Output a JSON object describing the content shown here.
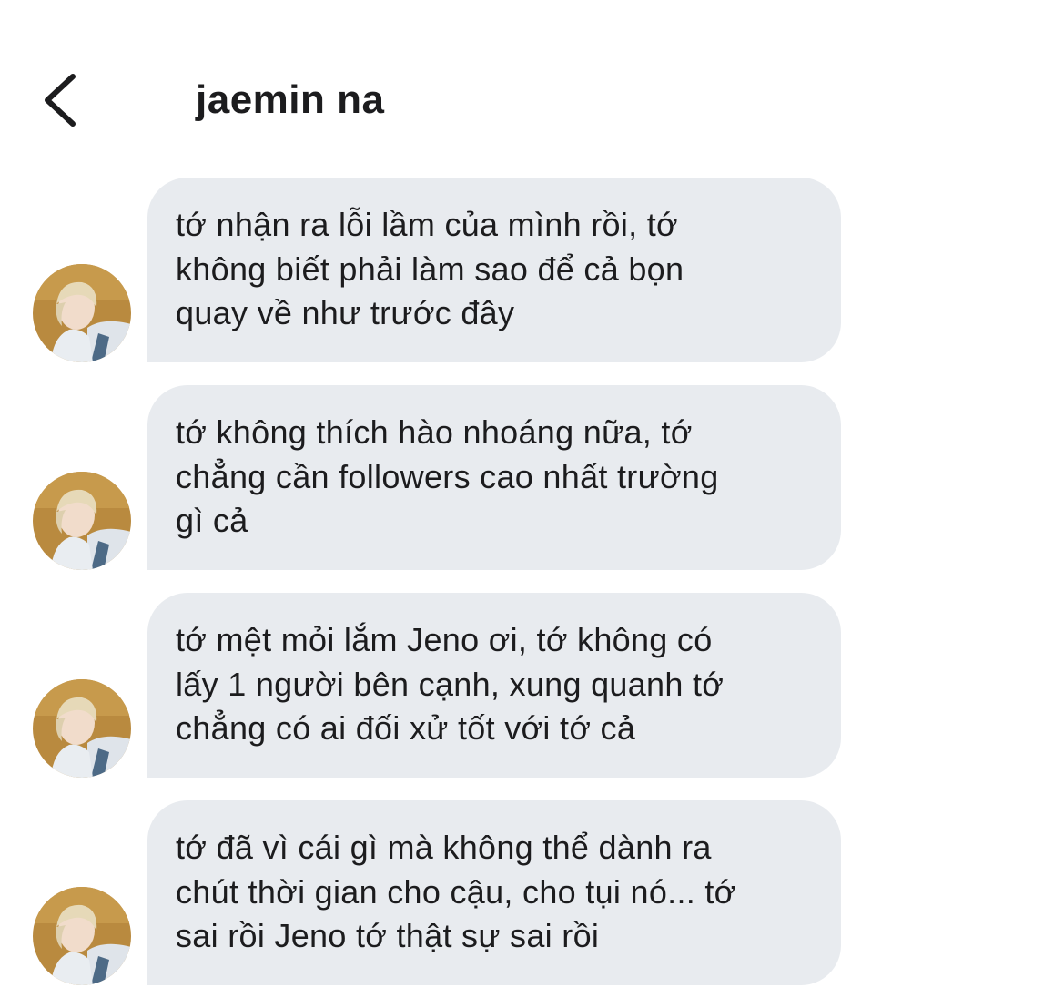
{
  "header": {
    "back_icon": "chevron-left-icon",
    "title": "jaemin na"
  },
  "messages": [
    {
      "text": "tớ nhận ra lỗi lầm của mình rồi, tớ\nkhông biết phải làm sao để cả bọn\nquay về như trước đây"
    },
    {
      "text": "tớ không thích hào nhoáng nữa, tớ\nchẳng cần followers cao nhất trường\ngì cả"
    },
    {
      "text": "tớ mệt mỏi lắm Jeno ơi, tớ không có\nlấy 1 người bên cạnh, xung quanh tớ\nchẳng có ai đối xử tốt với tớ cả"
    },
    {
      "text": "tớ đã vì cái gì mà không thể dành ra\nchút thời gian cho cậu, cho tụi nó... tớ\nsai rồi Jeno tớ thật sự sai rồi"
    }
  ],
  "colors": {
    "bubble": "#e8ebef",
    "text": "#1c1c1e",
    "background": "#ffffff"
  }
}
